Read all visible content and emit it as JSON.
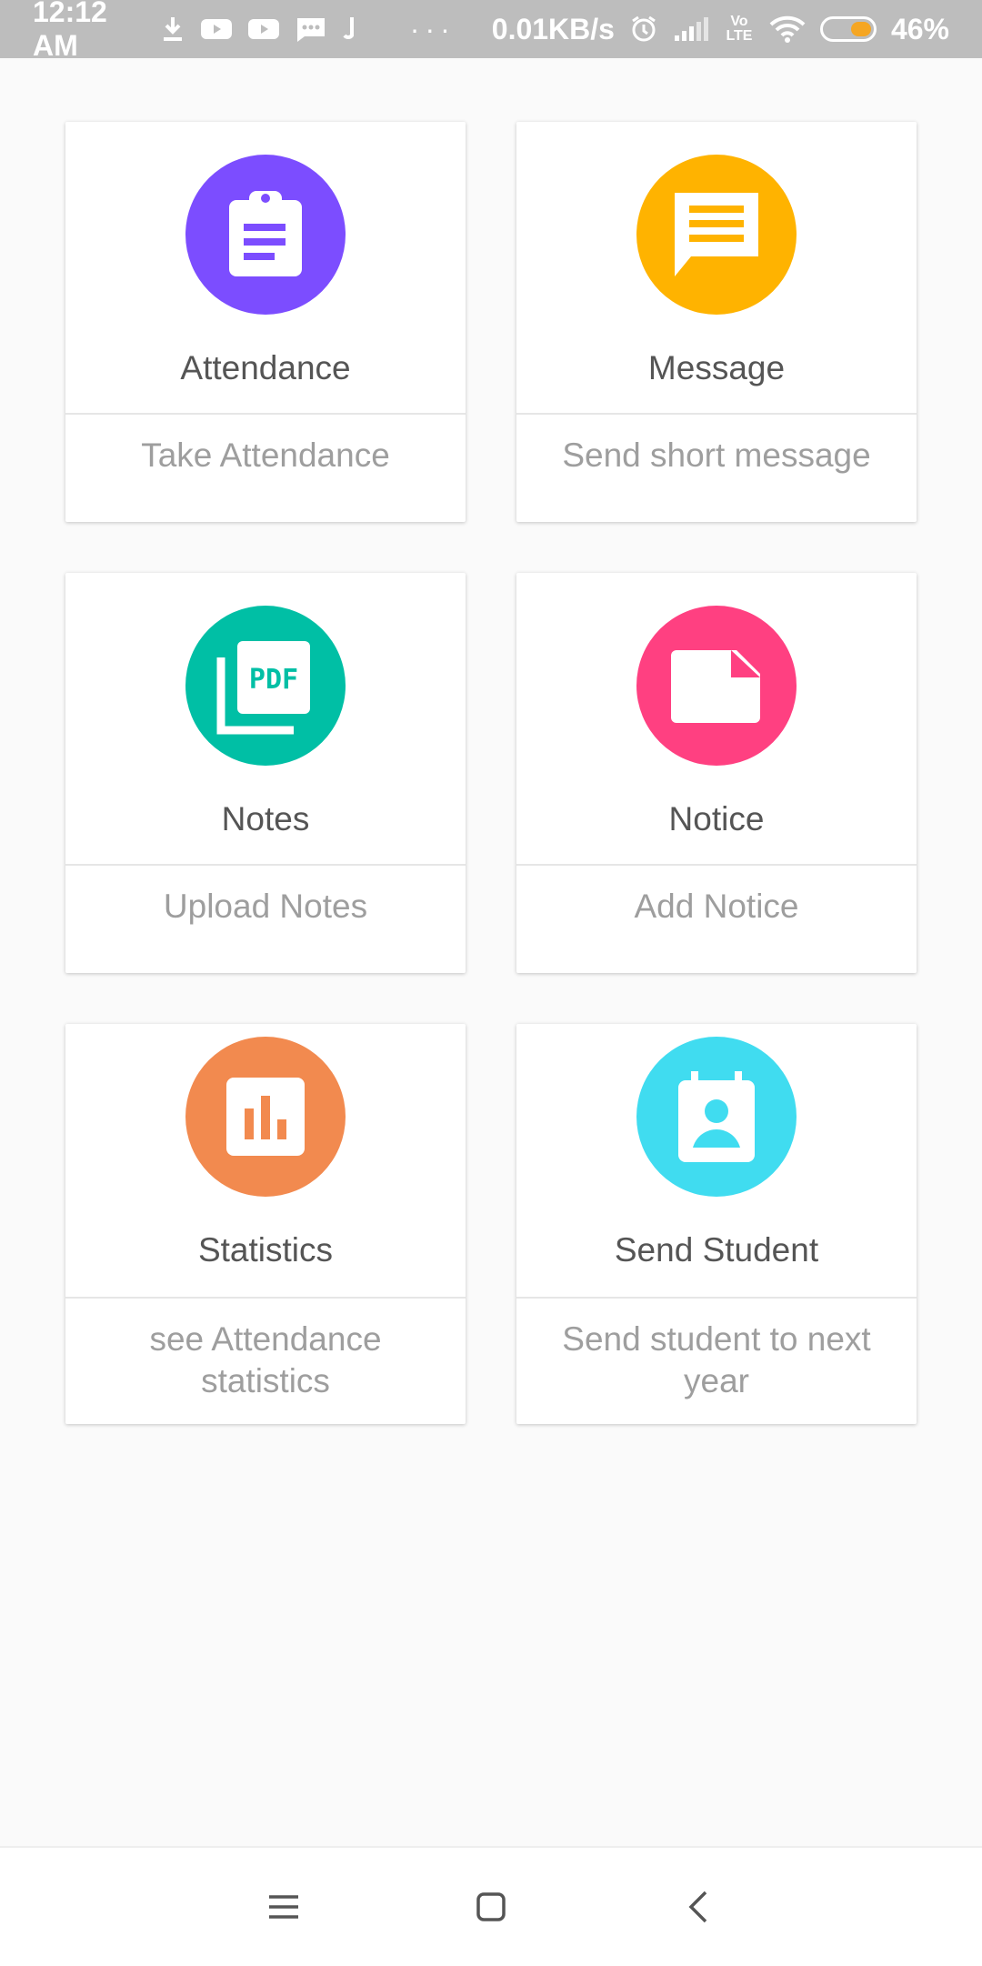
{
  "status_bar": {
    "time": "12:12 AM",
    "net_speed": "0.01KB/s",
    "network_label": "Vo LTE",
    "battery": "46%",
    "battery_color": "#f5a623",
    "icons": [
      "download-icon",
      "youtube-icon",
      "youtube-icon",
      "sms-icon",
      "music-icon",
      "more-dots-icon",
      "alarm-icon",
      "signal-icon",
      "wifi-icon",
      "battery-icon"
    ]
  },
  "cards": [
    {
      "title": "Attendance",
      "subtitle": "Take Attendance",
      "icon": "clipboard-icon",
      "color": "#7c4dff"
    },
    {
      "title": "Message",
      "subtitle": "Send short message",
      "icon": "message-icon",
      "color": "#ffb300"
    },
    {
      "title": "Notes",
      "subtitle": "Upload Notes",
      "icon": "pdf-icon",
      "color": "#00bfa5"
    },
    {
      "title": "Notice",
      "subtitle": "Add Notice",
      "icon": "note-icon",
      "color": "#ff4081"
    },
    {
      "title": "Statistics",
      "subtitle": "see Attendance statistics",
      "icon": "bar-chart-icon",
      "color": "#f28a4f"
    },
    {
      "title": "Send Student",
      "subtitle": "Send student to next year",
      "icon": "contact-card-icon",
      "color": "#40dcf0"
    }
  ],
  "nav": {
    "icons": [
      "menu-icon",
      "home-square-icon",
      "back-icon"
    ]
  }
}
